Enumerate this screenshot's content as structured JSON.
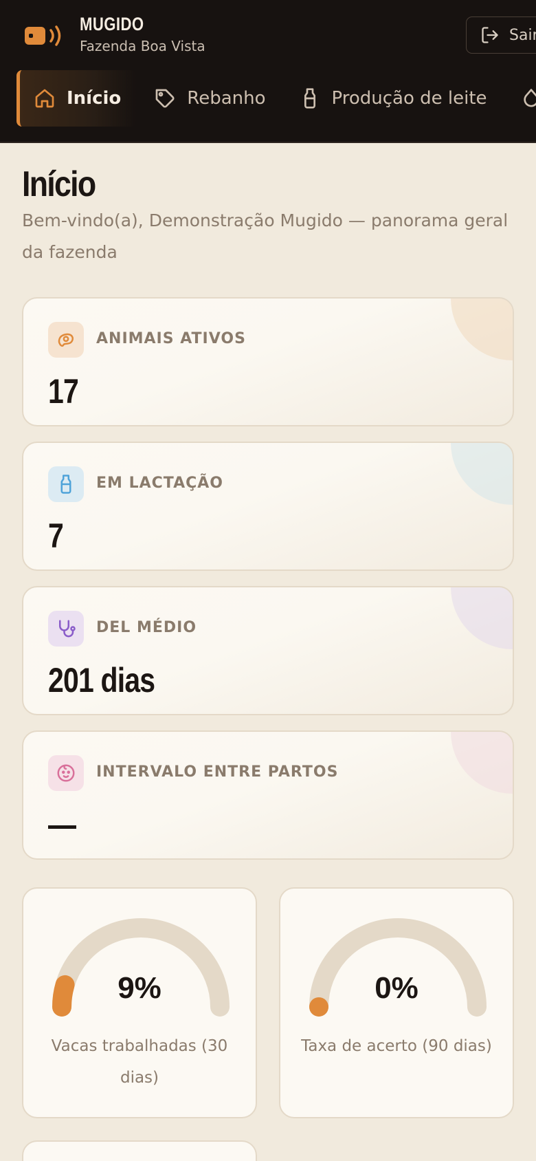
{
  "header": {
    "brand_name": "MUGIDO",
    "farm_name": "Fazenda Boa Vista",
    "logout_label": "Sair"
  },
  "nav": {
    "items": [
      {
        "label": "Início",
        "icon": "home-icon",
        "active": true
      },
      {
        "label": "Rebanho",
        "icon": "tag-icon"
      },
      {
        "label": "Produção de leite",
        "icon": "milk-bottle-icon"
      }
    ]
  },
  "page": {
    "title": "Início",
    "subtitle": "Bem-vindo(a), Demonstração Mugido — panorama geral da fazenda"
  },
  "stats": [
    {
      "label": "ANIMAIS ATIVOS",
      "value": "17",
      "icon": "cow-icon",
      "accent": "#e08a3a"
    },
    {
      "label": "EM LACTAÇÃO",
      "value": "7",
      "icon": "milk-bottle-icon",
      "accent": "#4fa3d9"
    },
    {
      "label": "DEL MÉDIO",
      "value": "201 dias",
      "icon": "stethoscope-icon",
      "accent": "#8a5cc9"
    },
    {
      "label": "INTERVALO ENTRE PARTOS",
      "value": "—",
      "icon": "baby-face-icon",
      "accent": "#d9709a"
    }
  ],
  "gauges": [
    {
      "value_text": "9%",
      "fraction": 0.09,
      "label": "Vacas trabalhadas (30 dias)"
    },
    {
      "value_text": "0%",
      "fraction": 0.0,
      "label": "Taxa de acerto (90 dias)"
    }
  ],
  "colors": {
    "accent": "#e08a3a",
    "header_bg": "#171210",
    "page_bg": "#f1eadd"
  }
}
